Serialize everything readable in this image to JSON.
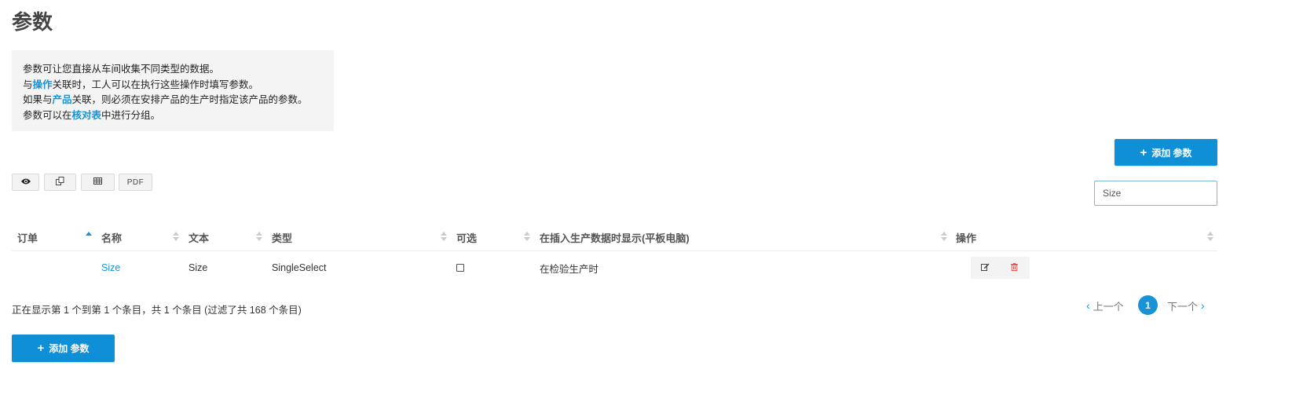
{
  "page": {
    "title": "参数"
  },
  "info": {
    "line1": "参数可让您直接从车间收集不同类型的数据。",
    "line2_prefix": "与",
    "line2_link": "操作",
    "line2_suffix": "关联时，工人可以在执行这些操作时填写参数。",
    "line3_prefix": "如果与",
    "line3_link": "产品",
    "line3_suffix": "关联，则必须在安排产品的生产时指定该产品的参数。",
    "line4_prefix": "参数可以在",
    "line4_link": "核对表",
    "line4_suffix": "中进行分组。"
  },
  "add_button": {
    "plus": "+",
    "label": "添加 参数"
  },
  "toolbar": {
    "pdf_label": "PDF"
  },
  "search": {
    "value": "Size",
    "placeholder": ""
  },
  "table": {
    "columns": [
      "订单",
      "名称",
      "文本",
      "类型",
      "可选",
      "在插入生产数据时显示(平板电脑)",
      "操作"
    ],
    "sorted_column": "订单",
    "rows": [
      {
        "name": "Size",
        "text": "Size",
        "type": "SingleSelect",
        "optional": false,
        "display": "在检验生产时"
      }
    ]
  },
  "footer": {
    "info": "正在显示第 1 个到第 1 个条目，共 1 个条目 (过滤了共 168 个条目)"
  },
  "pagination": {
    "prev": "上一个",
    "current": "1",
    "next": "下一个"
  },
  "colors": {
    "accent": "#1a93d6",
    "button": "#0f8fd6",
    "delete": "#e05a5a"
  }
}
